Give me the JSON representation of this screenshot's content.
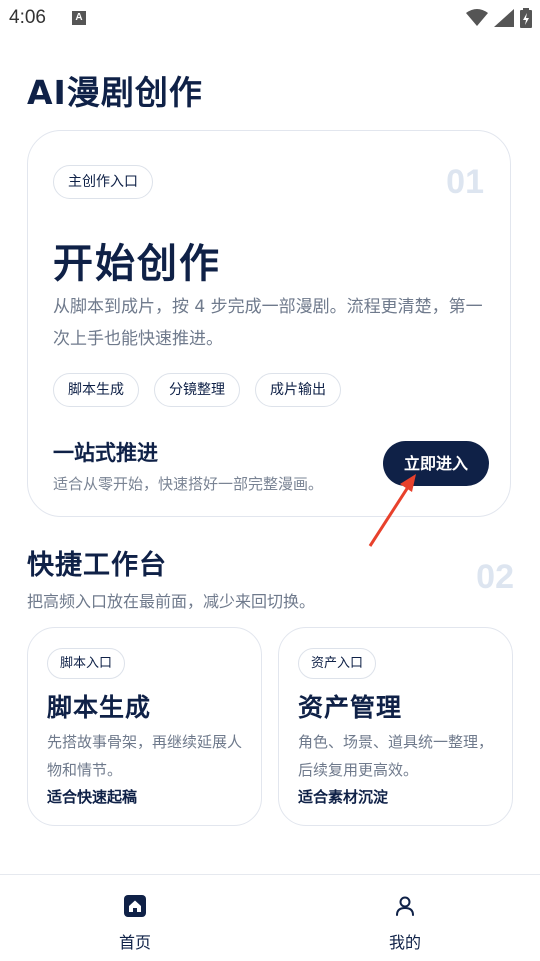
{
  "status_bar": {
    "time": "4:06",
    "notification_letter": "A"
  },
  "app_title": "AI漫剧创作",
  "hero": {
    "chip": "主创作入口",
    "number": "01",
    "title": "开始创作",
    "description": "从脚本到成片，按 4 步完成一部漫剧。流程更清楚，第一次上手也能快速推进。",
    "tags": [
      "脚本生成",
      "分镜整理",
      "成片输出"
    ],
    "sub_title": "一站式推进",
    "sub_desc": "适合从零开始，快速搭好一部完整漫画。",
    "button_label": "立即进入"
  },
  "quick_start": {
    "title": "快捷工作台",
    "description": "把高频入口放在最前面，减少来回切换。",
    "number": "02",
    "cards": [
      {
        "chip": "脚本入口",
        "title": "脚本生成",
        "description": "先搭故事骨架，再继续延展人物和情节。",
        "tag": "适合快速起稿"
      },
      {
        "chip": "资产入口",
        "title": "资产管理",
        "description": "角色、场景、道具统一整理，后续复用更高效。",
        "tag": "适合素材沉淀"
      }
    ]
  },
  "nav": {
    "items": [
      {
        "label": "首页",
        "icon": "home-icon"
      },
      {
        "label": "我的",
        "icon": "user-icon"
      }
    ]
  },
  "colors": {
    "primary": "#0f2147",
    "muted_text": "#6f7a8c",
    "number_watermark": "#dde5f0",
    "border": "#e2e6ee",
    "annotation_arrow": "#e8412c"
  }
}
